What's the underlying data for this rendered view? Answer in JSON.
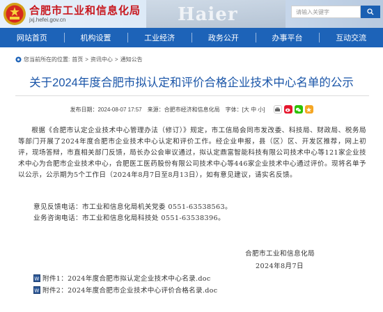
{
  "header": {
    "site_title": "合肥市工业和信息化局",
    "site_domain": "jxj.hefei.gov.cn",
    "banner_text": "Haier",
    "search_placeholder": "请输入关键字"
  },
  "nav": {
    "items": [
      "网站首页",
      "机构设置",
      "工业经济",
      "政务公开",
      "办事平台",
      "互动交流"
    ]
  },
  "breadcrumb": {
    "prefix": "您当前所在的位置:",
    "items": [
      "首页",
      "资讯中心",
      "通知公告"
    ],
    "separator": ">"
  },
  "article": {
    "title": "关于2024年度合肥市拟认定和评价合格企业技术中心名单的公示",
    "publish_label": "发布日期：",
    "publish_date": "2024-08-07 17:57",
    "source_label": "来源：",
    "source": "合肥市经济和信息化局",
    "font_label": "字体：",
    "font_options": "[大 中 小]",
    "paragraph": "根据《合肥市认定企业技术中心管理办法（修订）》规定，市工信局会同市发改委、科技局、财政局、税务局等部门开展了2024年度合肥市企业技术中心认定和评价工作。经企业申报，县（区）区、开发区推荐，网上初评，现场答辩，市直相关部门反馈，局长办公会审议通过，拟认定鼎富智能科技有限公司技术中心等121家企业技术中心为合肥市企业技术中心，合肥医工医药股份有限公司技术中心等446家企业技术中心通过评价。现将名单予以公示，公示期为5个工作日（2024年8月7日至8月13日），如有意见建议，请实名反馈。",
    "contacts": [
      "意见反馈电话：市工业和信息化局机关党委 0551-63538563。",
      "业务咨询电话：市工业和信息化局科技处 0551-63538396。"
    ],
    "signature_org": "合肥市工业和信息化局",
    "signature_date": "2024年8月7日",
    "attachments": [
      "附件1：2024年度合肥市拟认定企业技术中心名录.doc",
      "附件2：2024年度合肥市企业技术中心评价合格名录.doc"
    ]
  },
  "colors": {
    "brand_red": "#c8161d",
    "nav_blue": "#1d63b8",
    "title_blue": "#1a55a8"
  }
}
